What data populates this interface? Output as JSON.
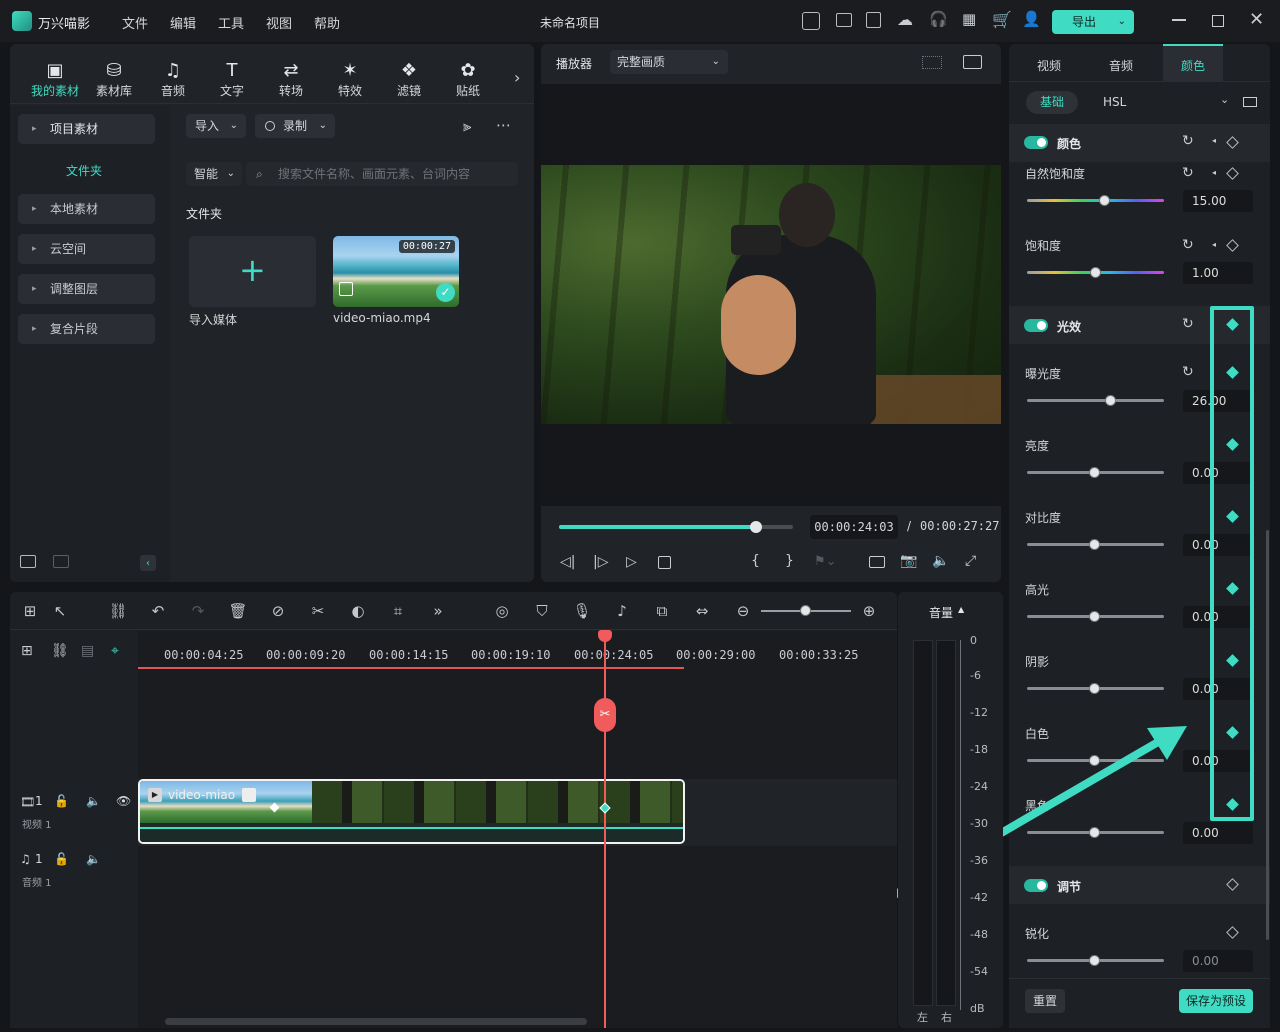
{
  "app": {
    "name": "万兴喵影",
    "project_title": "未命名项目",
    "export_label": "导出"
  },
  "menu": [
    "文件",
    "编辑",
    "工具",
    "视图",
    "帮助"
  ],
  "toolbar_tabs": [
    {
      "label": "我的素材",
      "icon": "media-icon",
      "active": true
    },
    {
      "label": "素材库",
      "icon": "library-icon"
    },
    {
      "label": "音频",
      "icon": "music-icon"
    },
    {
      "label": "文字",
      "icon": "text-icon"
    },
    {
      "label": "转场",
      "icon": "transition-icon"
    },
    {
      "label": "特效",
      "icon": "effects-icon"
    },
    {
      "label": "滤镜",
      "icon": "filter-icon"
    },
    {
      "label": "贴纸",
      "icon": "sticker-icon"
    }
  ],
  "sidebar": {
    "project_media": "项目素材",
    "folder": "文件夹",
    "items": [
      "本地素材",
      "云空间",
      "调整图层",
      "复合片段"
    ]
  },
  "media": {
    "import_label": "导入",
    "record_label": "录制",
    "smart_label": "智能",
    "search_placeholder": "搜索文件名称、画面元素、台词内容",
    "folder_heading": "文件夹",
    "import_media_label": "导入媒体",
    "clip_name": "video-miao.mp4",
    "clip_duration": "00:00:27"
  },
  "player": {
    "label": "播放器",
    "quality": "完整画质",
    "current_time": "00:00:24:03",
    "separator": "/",
    "total_time": "00:00:27:27",
    "progress": 0.84
  },
  "right_panel": {
    "tabs": [
      "视频",
      "音频",
      "颜色"
    ],
    "active_tab": "颜色",
    "subtabs": [
      "基础",
      "HSL"
    ],
    "sections": {
      "color": {
        "title": "颜色",
        "natural_saturation": "自然饱和度",
        "natural_saturation_value": "15.00",
        "saturation": "饱和度",
        "saturation_value": "1.00"
      },
      "light": {
        "title": "光效",
        "exposure": "曝光度",
        "exposure_value": "26.00",
        "brightness": "亮度",
        "contrast": "对比度",
        "highlight": "高光",
        "shadow": "阴影",
        "white": "白色",
        "black": "黑色",
        "zero": "0.00"
      },
      "adjust": {
        "title": "调节",
        "sharpen": "锐化",
        "sharpen_value": "0.00"
      }
    },
    "reset_label": "重置",
    "save_preset_label": "保存为预设"
  },
  "timeline": {
    "ticks": [
      "00:00:04:25",
      "00:00:09:20",
      "00:00:14:15",
      "00:00:19:10",
      "00:00:24:05",
      "00:00:29:00",
      "00:00:33:25"
    ],
    "video_track": {
      "number": "1",
      "name": "视频 1"
    },
    "audio_track": {
      "number": "1",
      "name": "音频 1"
    },
    "clip_label": "video-miao"
  },
  "audio_meter": {
    "title": "音量",
    "scale": [
      "0",
      "-6",
      "-12",
      "-18",
      "-24",
      "-30",
      "-36",
      "-42",
      "-48",
      "-54",
      "dB"
    ],
    "left": "左",
    "right": "右"
  },
  "colors": {
    "accent": "#3fdcc3",
    "playhead": "#f25b5b",
    "panel": "#202327",
    "background": "#141619"
  }
}
